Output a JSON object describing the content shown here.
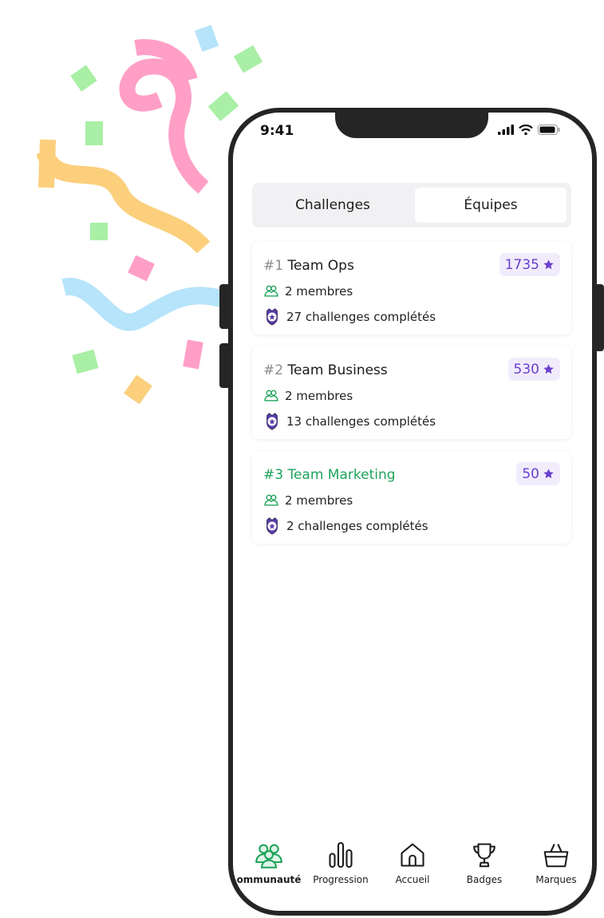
{
  "status_bar": {
    "time": "9:41"
  },
  "segmented": {
    "tabs": [
      {
        "label": "Challenges"
      },
      {
        "label": "Équipes"
      }
    ],
    "selected": "Équipes"
  },
  "teams": [
    {
      "rank": "#1",
      "name": "Team Ops",
      "points": "1735",
      "members": "2 membres",
      "challenges": "27 challenges complétés",
      "highlight": false
    },
    {
      "rank": "#2",
      "name": "Team Business",
      "points": "530",
      "members": "2 membres",
      "challenges": "13 challenges complétés",
      "highlight": false
    },
    {
      "rank": "#3",
      "name": "Team Marketing",
      "points": "50",
      "members": "2 membres",
      "challenges": "2 challenges complétés",
      "highlight": true
    }
  ],
  "nav": [
    {
      "label": "ommunauté",
      "icon": "community-icon",
      "active": true
    },
    {
      "label": "Progression",
      "icon": "bar-chart-icon",
      "active": false
    },
    {
      "label": "Accueil",
      "icon": "home-icon",
      "active": false
    },
    {
      "label": "Badges",
      "icon": "trophy-icon",
      "active": false
    },
    {
      "label": "Marques",
      "icon": "shopping-bag-icon",
      "active": false
    }
  ],
  "colors": {
    "accent_green": "#1fa45b",
    "points_purple": "#6a3fcf",
    "points_bg": "#f1ecfb",
    "frame": "#252525"
  }
}
